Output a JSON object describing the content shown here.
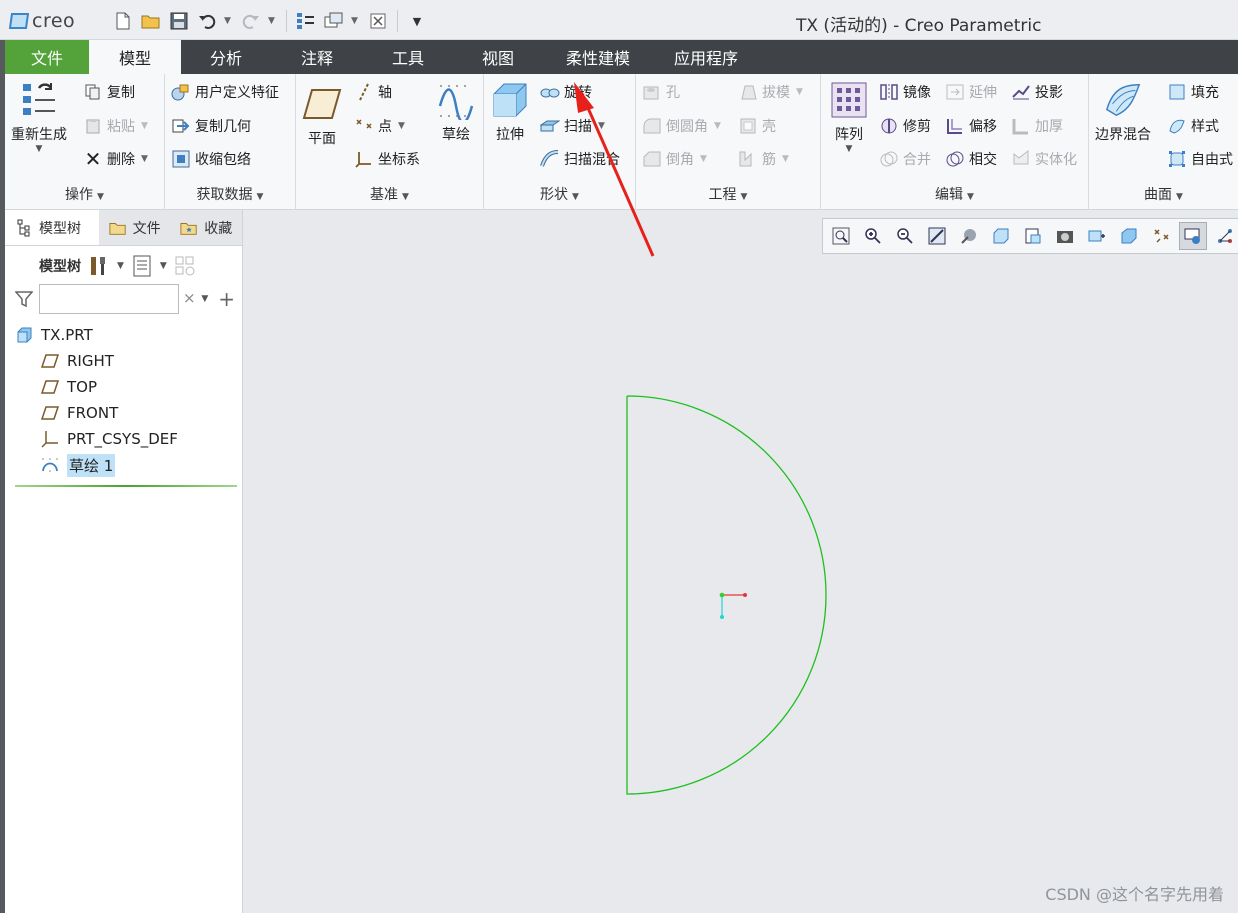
{
  "app": {
    "logo_text": "creo",
    "window_title": "TX (活动的) - Creo Parametric"
  },
  "quick_access": {
    "icons": [
      "new-icon",
      "open-icon",
      "save-icon",
      "undo-icon",
      "redo-icon",
      "regenerate-icon",
      "windows-icon",
      "close-window-icon",
      "customize-icon"
    ]
  },
  "tabs": [
    {
      "label": "文件"
    },
    {
      "label": "模型"
    },
    {
      "label": "分析"
    },
    {
      "label": "注释"
    },
    {
      "label": "工具"
    },
    {
      "label": "视图"
    },
    {
      "label": "柔性建模"
    },
    {
      "label": "应用程序"
    }
  ],
  "ribbon": {
    "operations": {
      "label": "操作",
      "regenerate": "重新生成",
      "copy": "复制",
      "paste": "粘贴",
      "delete": "删除"
    },
    "get_data": {
      "label": "获取数据",
      "udf": "用户定义特征",
      "copy_geom": "复制几何",
      "shrinkwrap": "收缩包络"
    },
    "datum": {
      "label": "基准",
      "plane": "平面",
      "axis": "轴",
      "point": "点",
      "csys": "坐标系",
      "sketch": "草绘"
    },
    "shapes": {
      "label": "形状",
      "extrude": "拉伸",
      "revolve": "旋转",
      "sweep": "扫描",
      "swept_blend": "扫描混合"
    },
    "engineering": {
      "label": "工程",
      "hole": "孔",
      "round": "倒圆角",
      "chamfer": "倒角",
      "draft": "拔模",
      "shell": "壳",
      "rib": "筋"
    },
    "editing": {
      "label": "编辑",
      "pattern": "阵列",
      "mirror": "镜像",
      "trim": "修剪",
      "merge": "合并",
      "extend": "延伸",
      "offset": "偏移",
      "intersect": "相交",
      "project": "投影",
      "thicken": "加厚",
      "solidify": "实体化"
    },
    "surfaces": {
      "label": "曲面",
      "boundary_blend": "边界混合",
      "fill": "填充",
      "style": "样式",
      "freestyle": "自由式"
    }
  },
  "panel": {
    "tabs": [
      {
        "label": "模型树"
      },
      {
        "label": "文件"
      },
      {
        "label": "收藏"
      }
    ],
    "toolbar_label": "模型树",
    "search_placeholder": "",
    "search_clear": "×",
    "tree": [
      {
        "label": "TX.PRT",
        "icon": "part-icon"
      },
      {
        "label": "RIGHT",
        "icon": "datum-plane-icon"
      },
      {
        "label": "TOP",
        "icon": "datum-plane-icon"
      },
      {
        "label": "FRONT",
        "icon": "datum-plane-icon"
      },
      {
        "label": "PRT_CSYS_DEF",
        "icon": "csys-icon"
      },
      {
        "label": "草绘 1",
        "icon": "sketch-icon",
        "selected": true
      }
    ]
  },
  "graphics": {
    "sketch_color": "#1fbf1f",
    "arrow_color": "#e8201c",
    "watermark": "CSDN @这个名字先用着"
  }
}
